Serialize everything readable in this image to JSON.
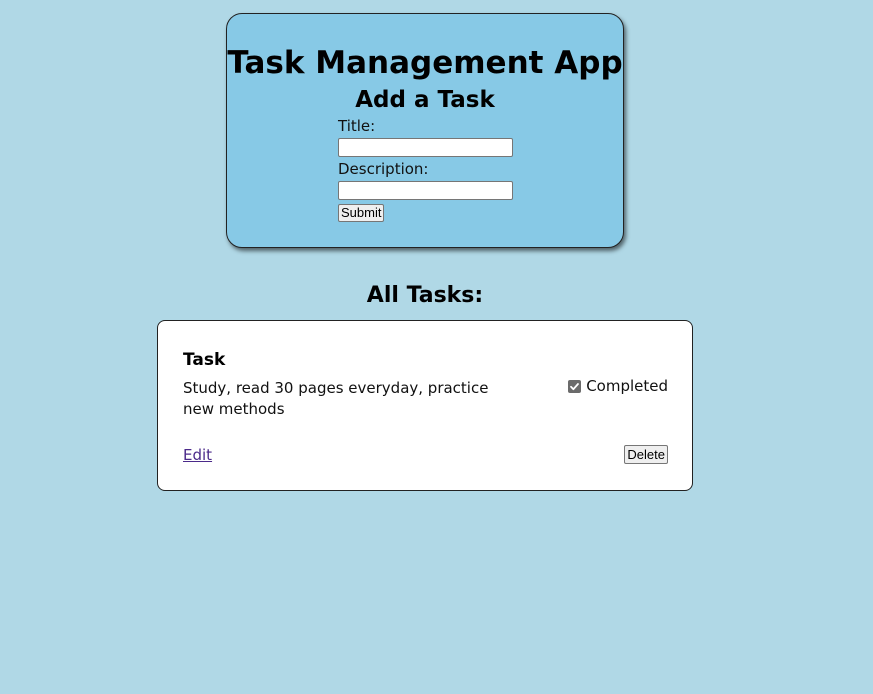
{
  "app": {
    "title": "Task Management App"
  },
  "add_form": {
    "heading": "Add a Task",
    "title_label": "Title:",
    "title_value": "",
    "description_label": "Description:",
    "description_value": "",
    "submit_label": "Submit"
  },
  "tasks_section": {
    "heading": "All Tasks:",
    "tasks": [
      {
        "title": "Task",
        "description": "Study, read 30 pages everyday, practice new methods",
        "completed": true,
        "completed_label": "Completed",
        "edit_label": "Edit",
        "delete_label": "Delete"
      }
    ]
  },
  "colors": {
    "page_background": "#b0d8e6",
    "header_card_background": "#87c9e6",
    "task_card_background": "#ffffff",
    "link_color": "#4b2a8a"
  }
}
